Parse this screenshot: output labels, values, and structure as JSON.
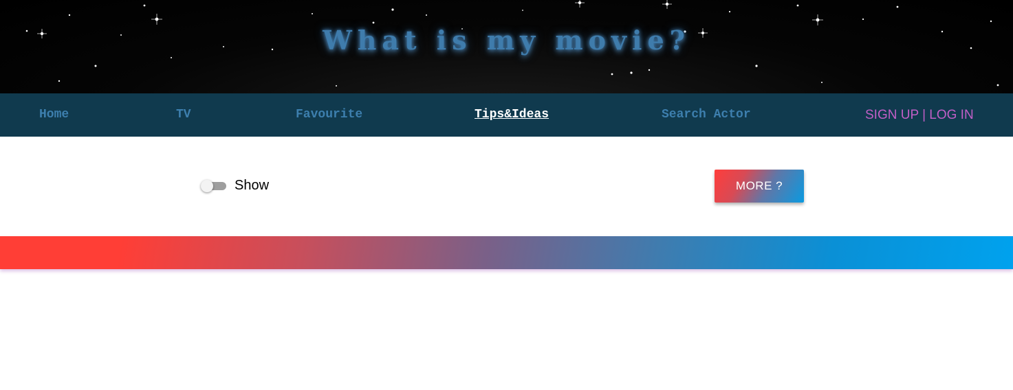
{
  "header": {
    "title": "What is my movie?"
  },
  "nav": {
    "items": [
      {
        "label": "Home"
      },
      {
        "label": "TV"
      },
      {
        "label": "Favourite"
      },
      {
        "label": "Tips&Ideas",
        "active": true
      },
      {
        "label": "Search Actor"
      }
    ],
    "auth": {
      "signup": "SIGN UP",
      "separator": "|",
      "login": "LOG IN"
    }
  },
  "controls": {
    "toggle_label": "Show",
    "toggle_on": false,
    "more_button": "MORE ?"
  },
  "colors": {
    "nav_background": "#103a4e",
    "nav_link": "#3d7fae",
    "auth_link": "#c15fc7",
    "gradient_start": "#ff3e36",
    "gradient_end": "#00a2ee"
  }
}
